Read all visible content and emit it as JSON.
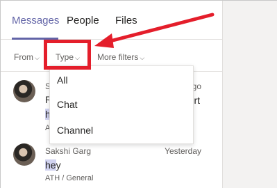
{
  "tabs": [
    {
      "label": "Messages",
      "active": true
    },
    {
      "label": "People",
      "active": false
    },
    {
      "label": "Files",
      "active": false
    }
  ],
  "filters": {
    "from": "From",
    "type": "Type",
    "more": "More filters",
    "chevron": "⌵"
  },
  "type_dropdown": {
    "options": [
      "All",
      "Chat",
      "Channel"
    ]
  },
  "messages": [
    {
      "sender_partial": "S",
      "time_partial": "go",
      "line2_start": "R",
      "line2_end": "rt",
      "line3_partial": "h",
      "channel_partial": "A"
    },
    {
      "sender": "Sakshi Garg",
      "time": "Yesterday",
      "body_highlight": "he",
      "body_rest": "y",
      "channel": "ATH / General"
    }
  ],
  "colors": {
    "accent": "#6264a7",
    "annotation_red": "#e41e2b",
    "highlight": "#d1d3f0"
  }
}
